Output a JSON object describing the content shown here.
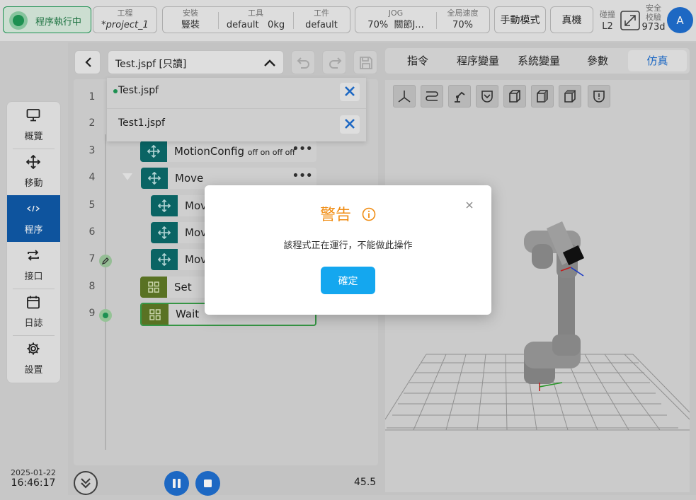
{
  "header": {
    "status_label": "程序執行中",
    "project": {
      "label": "工程",
      "value": "*project_1"
    },
    "install": {
      "label": "安裝",
      "value": "豎裝"
    },
    "tool": {
      "label": "工具",
      "name": "default",
      "weight": "0kg"
    },
    "workpiece": {
      "label": "工件",
      "value": "default"
    },
    "jog": {
      "label": "JOG",
      "speed": "70%",
      "mode": "關節J..."
    },
    "global_speed": {
      "label": "全局速度",
      "value": "70%"
    },
    "manual_mode": "手動模式",
    "real_machine": "真機",
    "collision": {
      "label": "碰撞",
      "value": "L2"
    },
    "safety": {
      "label1": "安全",
      "label2": "校驗",
      "value": "973d"
    },
    "avatar": "A",
    "colors": {
      "status_green": "#1f9a57",
      "accent_blue": "#1f6fd0"
    }
  },
  "sidebar": {
    "items": [
      {
        "label": "概覽",
        "icon": "monitor-icon"
      },
      {
        "label": "移動",
        "icon": "move-arrows-icon"
      },
      {
        "label": "程序",
        "icon": "code-icon"
      },
      {
        "label": "接口",
        "icon": "swap-icon"
      },
      {
        "label": "日誌",
        "icon": "calendar-icon"
      },
      {
        "label": "設置",
        "icon": "gear-icon"
      }
    ]
  },
  "datetime": {
    "date": "2025-01-22",
    "time": "16:46:17"
  },
  "program": {
    "file_select": "Test.jspf [只讀]",
    "open_files": [
      {
        "name": "Test.jspf"
      },
      {
        "name": "Test1.jspf"
      }
    ],
    "lines": [
      "1",
      "2",
      "3",
      "4",
      "5",
      "6",
      "7",
      "8",
      "9"
    ],
    "blocks": [
      {
        "text": "MotionConfig",
        "extra": "off on off off"
      },
      {
        "text": "Move"
      },
      {
        "text": "Move"
      },
      {
        "text": "Move"
      },
      {
        "text": "Move"
      },
      {
        "text": "Set"
      },
      {
        "text": "Wait"
      }
    ],
    "dots": "•••",
    "speed_value": "45.5"
  },
  "right_tabs": [
    "指令",
    "程序變量",
    "系統變量",
    "參數",
    "仿真"
  ],
  "modal": {
    "title": "警告",
    "message": "該程式正在運行，不能做此操作",
    "ok_label": "確定"
  }
}
